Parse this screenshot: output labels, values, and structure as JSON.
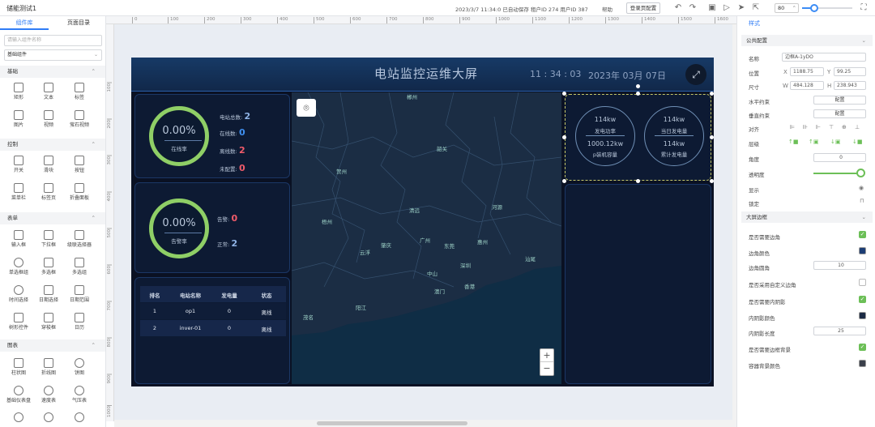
{
  "app": {
    "title": "储能测试1",
    "save_status": "2023/3/7 11:34:0 已自动保存  租户ID 274 用户ID 387",
    "help": "帮助",
    "login_config": "登录页配置",
    "zoom": "80"
  },
  "left_panel": {
    "tabs": [
      "组件库",
      "页面目录"
    ],
    "search_placeholder": "请输入组件名称",
    "component_set": "基础组件",
    "sections": [
      {
        "title": "基础",
        "items": [
          "矩形",
          "文本",
          "标签",
          "图片",
          "视频",
          "萤石视频"
        ]
      },
      {
        "title": "控制",
        "items": [
          "开关",
          "滑块",
          "按钮",
          "菜单栏",
          "标签页",
          "折叠面板"
        ]
      },
      {
        "title": "表单",
        "items": [
          "输入框",
          "下拉框",
          "级联选择器",
          "单选框组",
          "多选框",
          "多选组",
          "时间选择",
          "日期选择",
          "日期范围",
          "树形控件",
          "穿梭框",
          "日历"
        ]
      },
      {
        "title": "图表",
        "items": [
          "柱状图",
          "折线图",
          "饼图",
          "基础仪表盘",
          "速度表",
          "气压表"
        ]
      }
    ]
  },
  "ruler": {
    "top": [
      "0",
      "100",
      "200",
      "300",
      "400",
      "500",
      "600",
      "700",
      "800",
      "900",
      "1000",
      "1100",
      "1200",
      "1300",
      "1400",
      "1500",
      "1600"
    ],
    "left": [
      "100",
      "200",
      "300",
      "400",
      "500",
      "600",
      "700",
      "800",
      "900",
      "1000"
    ]
  },
  "screen": {
    "title": "电站监控运维大屏",
    "time": "11 : 34 : 03",
    "date": "2023年 03月 07日",
    "station_ring": {
      "value": "0.00%",
      "label": "在线率"
    },
    "station_stats": [
      {
        "label": "电站总数:",
        "value": "2",
        "color": "#8fb3e6"
      },
      {
        "label": "在线数:",
        "value": "0",
        "color": "#3f8ff0"
      },
      {
        "label": "离线数:",
        "value": "2",
        "color": "#f05b6a"
      },
      {
        "label": "未配置:",
        "value": "0",
        "color": "#f05b6a"
      }
    ],
    "alarm_ring": {
      "value": "0.00%",
      "label": "告警率"
    },
    "alarm_stats": [
      {
        "label": "告警:",
        "value": "0",
        "color": "#f05b6a"
      },
      {
        "label": "正常:",
        "value": "2",
        "color": "#8fb3e6"
      }
    ],
    "table": {
      "headers": [
        "排名",
        "电站名称",
        "发电量",
        "状态"
      ],
      "rows": [
        [
          "1",
          "op1",
          "0",
          "离线"
        ],
        [
          "2",
          "inver-01",
          "0",
          "离线"
        ]
      ]
    },
    "power": [
      {
        "v1": "114kw",
        "l1": "发电功率",
        "v2": "1000.12kw",
        "l2": "p装机容量"
      },
      {
        "v1": "114kw",
        "l1": "当日发电量",
        "v2": "114kw",
        "l2": "累计发电量"
      }
    ],
    "map_cities": [
      "郴州",
      "韶关",
      "贺州",
      "河源",
      "清远",
      "梧州",
      "广州",
      "惠州",
      "肇庆",
      "东莞",
      "云浮",
      "汕尾",
      "深圳",
      "中山",
      "澳门",
      "香港",
      "阳江",
      "茂名"
    ],
    "zoom_in": "+",
    "zoom_out": "−"
  },
  "right_panel": {
    "tab": "样式",
    "section_common": "公共配置",
    "name_label": "名称",
    "name_value": "边框A-1yDO",
    "pos_label": "位置",
    "pos_x_label": "X",
    "pos_x": "1188.75",
    "pos_y_label": "Y",
    "pos_y": "99.25",
    "size_label": "尺寸",
    "size_w_label": "W",
    "size_w": "484.128",
    "size_h_label": "H",
    "size_h": "238.943",
    "hconstraint_label": "水平约束",
    "hconstraint": "配置",
    "vconstraint_label": "垂直约束",
    "vconstraint": "配置",
    "align_label": "对齐",
    "layer_label": "层级",
    "angle_label": "角度",
    "angle": "0",
    "opacity_label": "透明度",
    "display_label": "显示",
    "lock_label": "锁定",
    "section_border": "大屏边框",
    "props": [
      {
        "label": "是否需要边角",
        "type": "check",
        "on": true
      },
      {
        "label": "边角颜色",
        "type": "color",
        "color": "#1c3d74"
      },
      {
        "label": "边角圆角",
        "type": "number",
        "value": "10"
      },
      {
        "label": "是否采用自定义边角",
        "type": "check",
        "on": false
      },
      {
        "label": "是否需要内阴影",
        "type": "check",
        "on": true
      },
      {
        "label": "内阴影颜色",
        "type": "color",
        "color": "#1c2a44"
      },
      {
        "label": "内阴影长度",
        "type": "number",
        "value": "25"
      },
      {
        "label": "是否需要边框背景",
        "type": "check",
        "on": true
      },
      {
        "label": "容器背景颜色",
        "type": "color",
        "color": "#3a3f4a"
      }
    ]
  }
}
